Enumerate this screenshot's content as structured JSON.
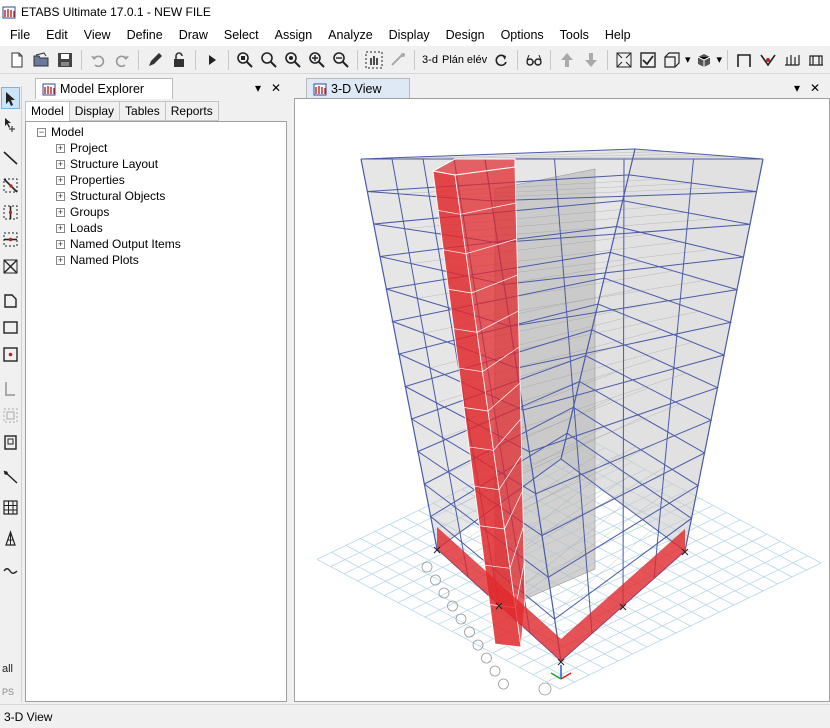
{
  "window": {
    "title": "ETABS Ultimate 17.0.1 - NEW FILE"
  },
  "menu": [
    "File",
    "Edit",
    "View",
    "Define",
    "Draw",
    "Select",
    "Assign",
    "Analyze",
    "Display",
    "Design",
    "Options",
    "Tools",
    "Help"
  ],
  "toolbar": {
    "view_3d_label": "3-d",
    "plan_label": "Plán",
    "elev_label": "elév"
  },
  "left_toolbar": {
    "all_label": "all",
    "ps_label": "PS"
  },
  "explorer": {
    "tab_title": "Model Explorer",
    "subtabs": [
      "Model",
      "Display",
      "Tables",
      "Reports"
    ],
    "root": "Model",
    "items": [
      "Project",
      "Structure Layout",
      "Properties",
      "Structural Objects",
      "Groups",
      "Loads",
      "Named Output Items",
      "Named Plots"
    ],
    "pin_glyph": "▾",
    "close_glyph": "✕"
  },
  "view": {
    "tab_title": "3-D View",
    "pin_glyph": "▾",
    "close_glyph": "✕"
  },
  "status": {
    "text": "3-D View"
  },
  "colors": {
    "frame_blue": "#4a5aa8",
    "wall_red": "#e0282c",
    "grid_cyan": "#b8d8e8",
    "slab_gray": "#c8c8c8"
  }
}
